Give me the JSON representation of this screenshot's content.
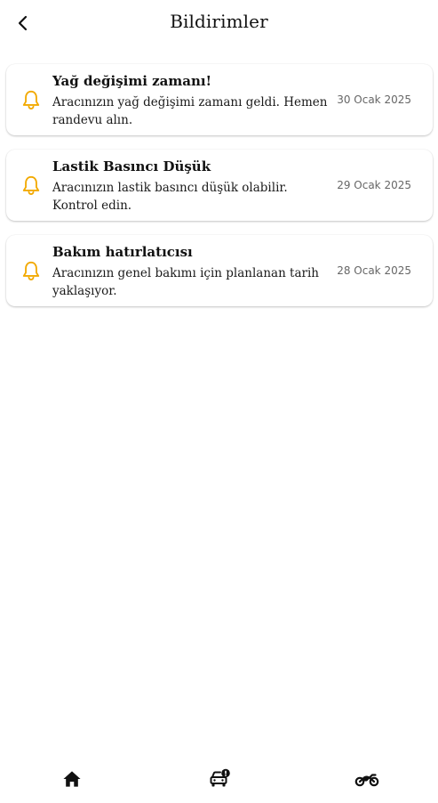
{
  "header": {
    "title": "Bildirimler",
    "back_icon": "chevron-left-icon"
  },
  "notifications": [
    {
      "title": "Yağ değişimi zamanı!",
      "message": "Aracınızın yağ değişimi zamanı geldi. Hemen randevu alın.",
      "date": "30 Ocak 2025",
      "icon": "bell-icon"
    },
    {
      "title": "Lastik Basıncı Düşük",
      "message": "Aracınızın lastik basıncı düşük olabilir. Kontrol edin.",
      "date": "29 Ocak 2025",
      "icon": "bell-icon"
    },
    {
      "title": "Bakım hatırlatıcısı",
      "message": "Aracınızın genel bakımı için planlanan tarih yaklaşıyor.",
      "date": "28 Ocak 2025",
      "icon": "bell-icon"
    }
  ],
  "bottom_nav": {
    "items": [
      {
        "icon": "home-icon"
      },
      {
        "icon": "car-alert-icon"
      },
      {
        "icon": "motorcycle-icon"
      }
    ]
  },
  "colors": {
    "accent": "#F2A900",
    "text": "#111111",
    "muted": "#666666"
  }
}
